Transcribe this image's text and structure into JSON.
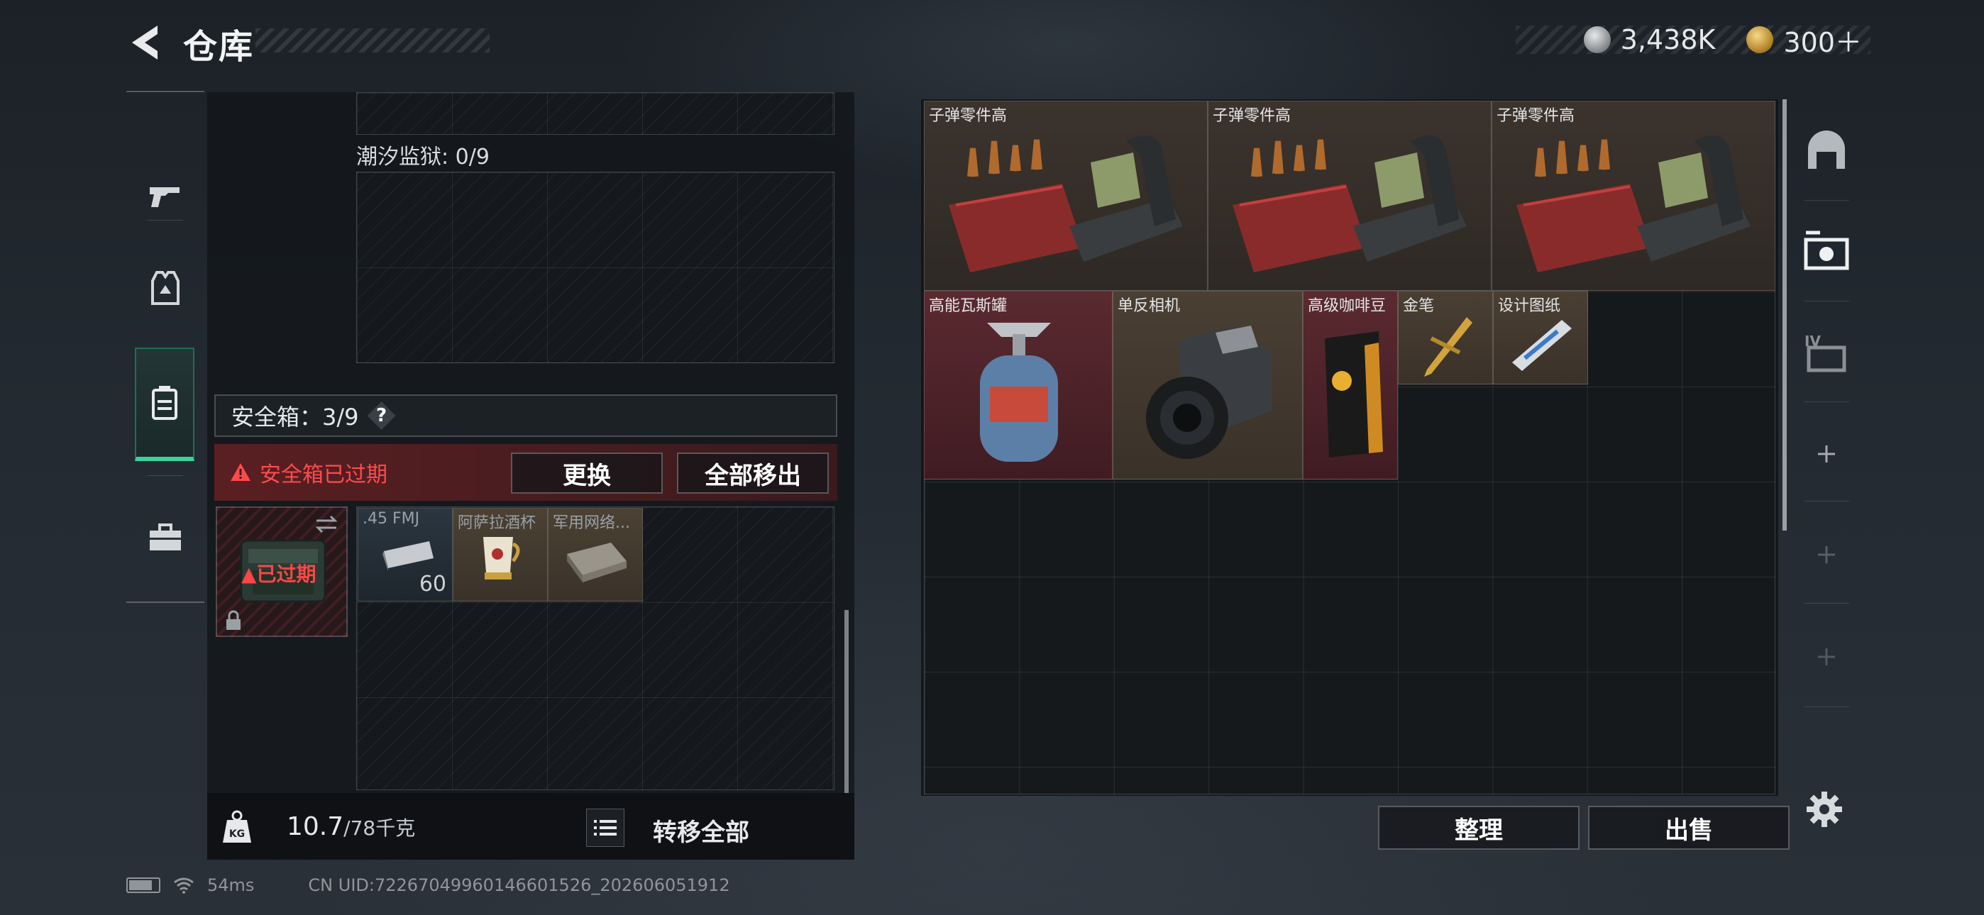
{
  "header": {
    "title": "仓库",
    "currency": [
      {
        "icon": "silver-coin-icon",
        "value": "3,438K"
      },
      {
        "icon": "gold-coin-icon",
        "value": "300＋"
      }
    ]
  },
  "left_nav": {
    "items": [
      {
        "icon": "pistol-icon",
        "active": false
      },
      {
        "icon": "armor-vest-icon",
        "active": false
      },
      {
        "icon": "backpack-icon",
        "active": true
      },
      {
        "icon": "briefcase-icon",
        "active": false
      }
    ]
  },
  "container": {
    "tide_prison_label": "潮汐监狱: 0/9"
  },
  "safebox": {
    "title": "安全箱：3/9",
    "help": "?",
    "expired_text": "安全箱已过期",
    "replace_button": "更换",
    "remove_all_button": "全部移出",
    "item_expired_label": "已过期",
    "items": [
      {
        "label": ".45 FMJ",
        "count": "60"
      },
      {
        "label": "阿萨拉酒杯",
        "count": ""
      },
      {
        "label": "军用网络...",
        "count": ""
      }
    ]
  },
  "bottom": {
    "weight_current": "10.7",
    "weight_max": "/78千克",
    "weight_icon_text": "KG",
    "transfer_all": "转移全部"
  },
  "warehouse": {
    "items": [
      {
        "label": "子弹零件高"
      },
      {
        "label": "子弹零件高"
      },
      {
        "label": "子弹零件高"
      },
      {
        "label": "高能瓦斯罐"
      },
      {
        "label": "单反相机"
      },
      {
        "label": "高级咖啡豆"
      },
      {
        "label": "金笔"
      },
      {
        "label": "设计图纸"
      }
    ],
    "sort_button": "整理",
    "sell_button": "出售"
  },
  "right_nav": {
    "items": [
      "garage-icon",
      "warehouse-tab-icon",
      "warehouse-iv-icon",
      "add-icon",
      "add-icon",
      "add-icon",
      "add-icon"
    ]
  },
  "status": {
    "ping": "54ms",
    "uid": "CN UID:7226704996014660152­6_202606051912"
  }
}
